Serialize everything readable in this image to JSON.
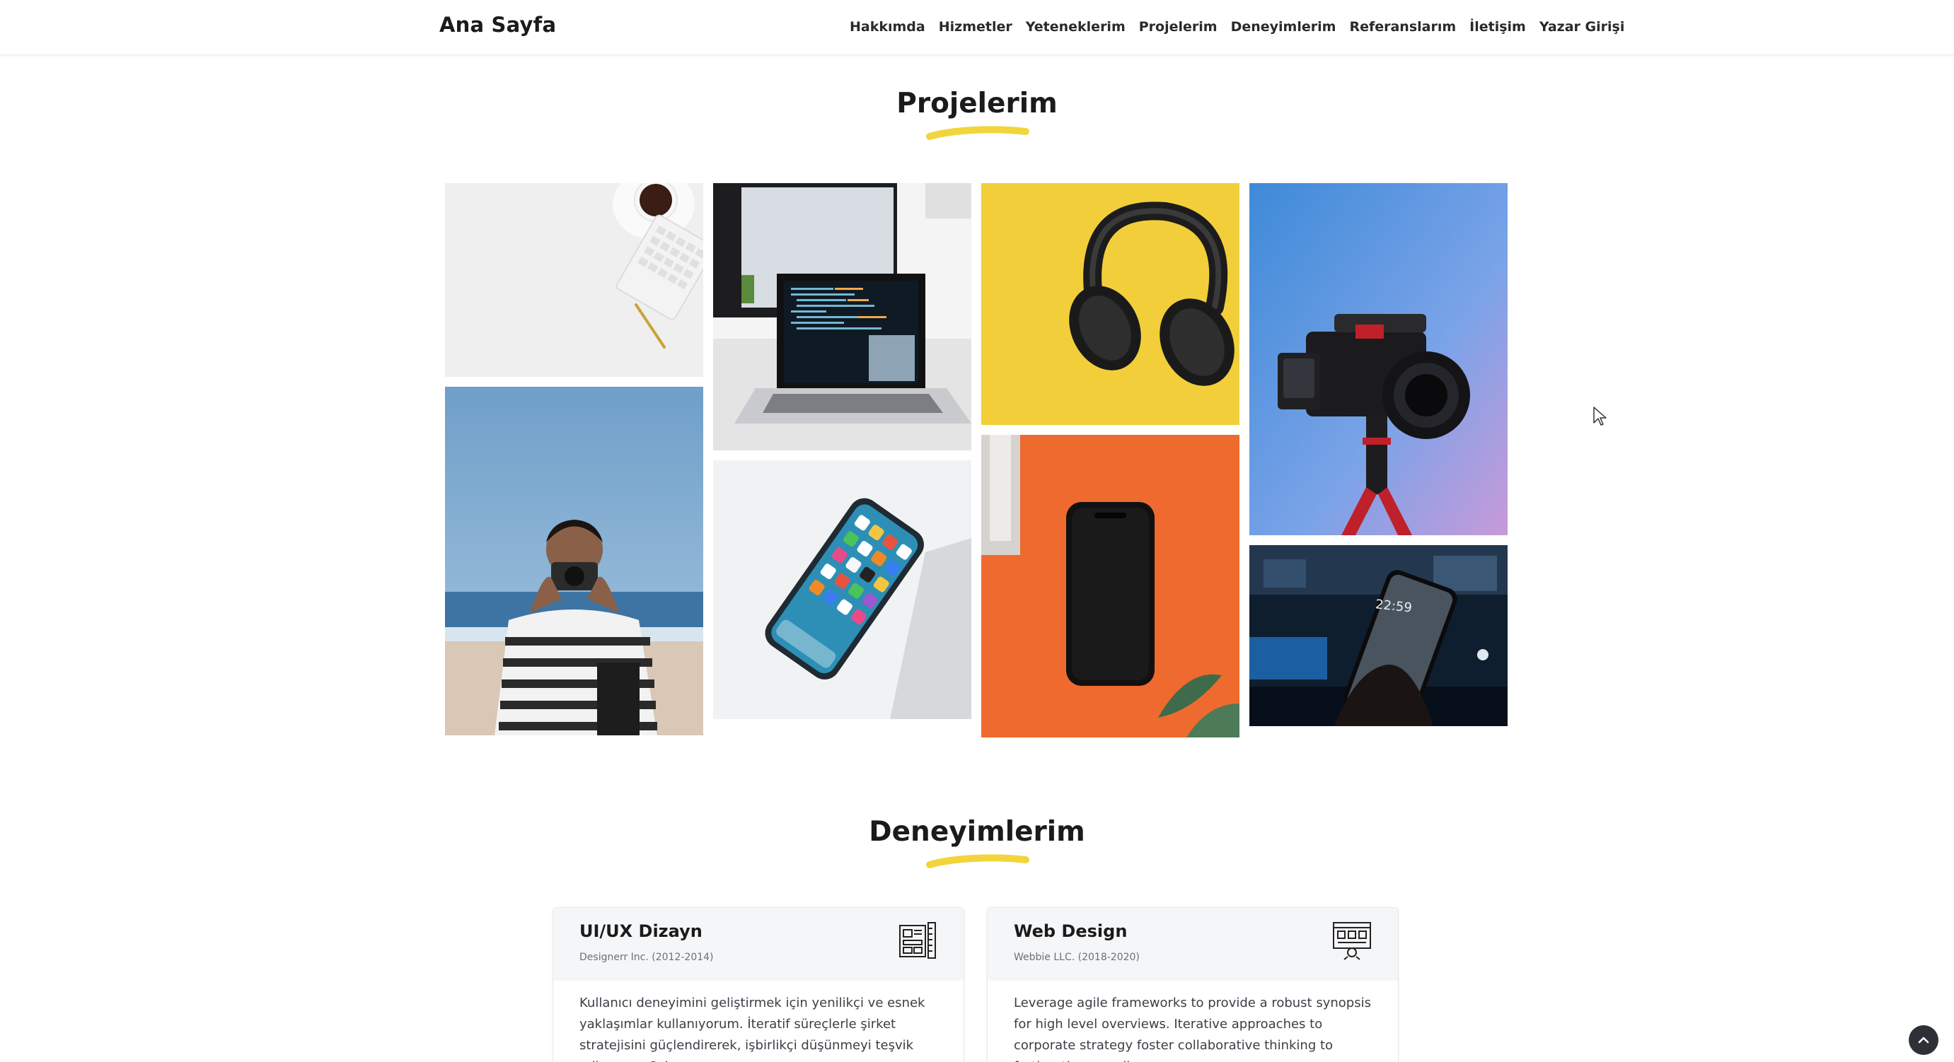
{
  "nav": {
    "brand": "Ana Sayfa",
    "links": [
      "Hakkımda",
      "Hizmetler",
      "Yeteneklerim",
      "Projelerim",
      "Deneyimlerim",
      "Referanslarım",
      "İletişim",
      "Yazar Girişi"
    ]
  },
  "projects": {
    "title": "Projelerim",
    "images": [
      "desk-workspace-image",
      "person-camera-beach-image",
      "laptop-code-image",
      "smartphone-apps-image",
      "headphones-yellow-image",
      "phone-orange-image",
      "camera-rig-image",
      "phone-night-image"
    ],
    "phone_clock": "22:59"
  },
  "experience": {
    "title": "Deneyimlerim",
    "cards": [
      {
        "title": "UI/UX Dizayn",
        "meta": "Designerr Inc. (2012-2014)",
        "icon": "ui-design-icon",
        "body": "Kullanıcı deneyimini geliştirmek için yenilikçi ve esnek yaklaşımlar kullanıyorum. İteratif süreçlerle şirket stratejisini güçlendirerek, işbirlikçi düşünmeyi teşvik ediyorum. Çalışma"
      },
      {
        "title": "Web Design",
        "meta": "Webbie LLC. (2018-2020)",
        "icon": "web-design-icon",
        "body": "Leverage agile frameworks to provide a robust synopsis for high level overviews. Iterative approaches to corporate strategy foster collaborative thinking to further the overall"
      }
    ]
  },
  "colors": {
    "accent": "#f2d53c",
    "text": "#1b1b1b",
    "card_head": "#f5f6f8",
    "scroll_button": "#2d3036"
  },
  "icons": {
    "scroll_top": "chevron-up-icon",
    "cursor": "mouse-pointer-icon"
  }
}
